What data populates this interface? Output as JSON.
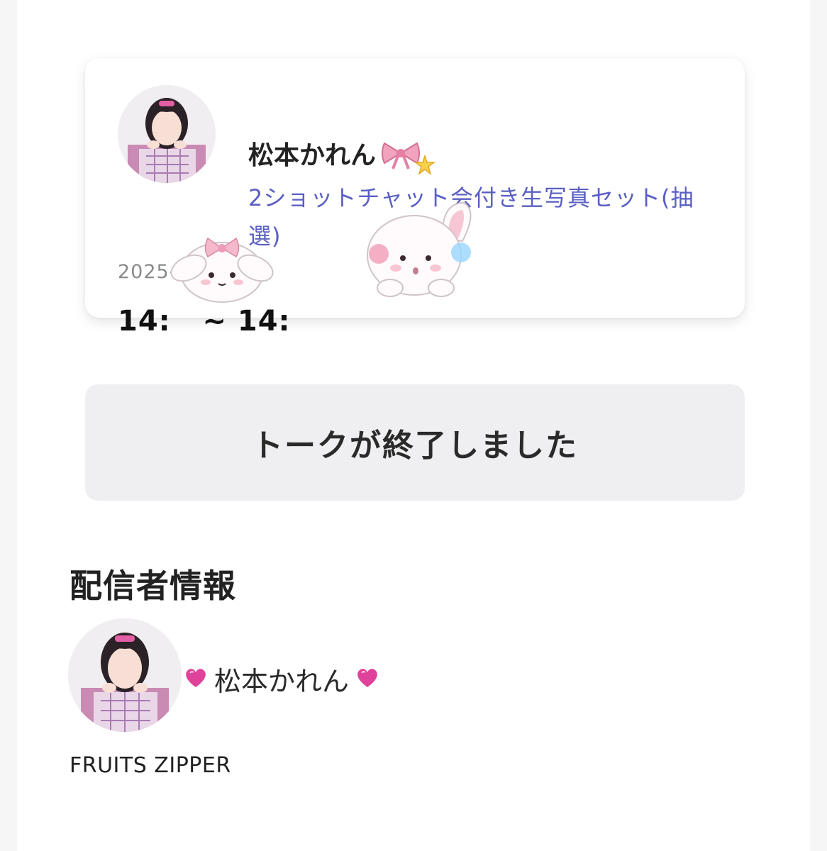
{
  "card": {
    "name": "松本かれん",
    "name_icons": [
      "ribbon-icon",
      "star-icon"
    ],
    "product": "2ショットチャット会付き生写真セット(抽選)",
    "date": "2025-06-15",
    "time": "14:   ~ 14:"
  },
  "ended_button": {
    "label": "トークが終了しました"
  },
  "streamer_section": {
    "title": "配信者情報",
    "name": "松本かれん",
    "group": "FRUITS ZIPPER"
  },
  "colors": {
    "accent": "#5a5fc4",
    "button_bg": "#efeff1",
    "heart": "#e0419a"
  }
}
